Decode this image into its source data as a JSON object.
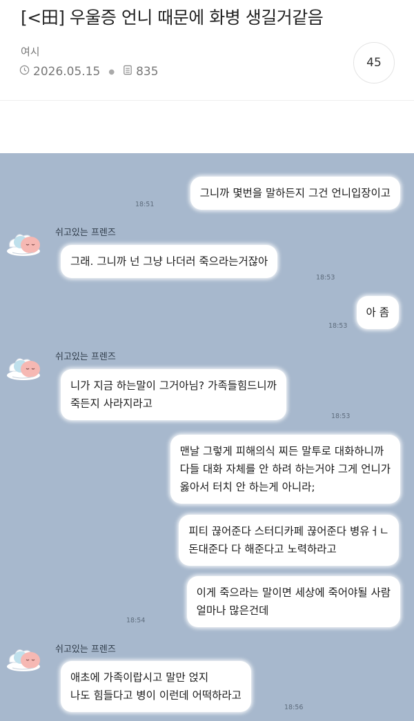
{
  "post": {
    "title": "[<田] 우울증 언니 때문에 화병 생길거같음",
    "author": "여시",
    "date": "2026.05.15",
    "views": "835",
    "comment_count": "45"
  },
  "icons": {
    "date": "clock-icon",
    "views": "document-icon",
    "avatar": "sleeping-peach-character-icon"
  },
  "colors": {
    "chat_background": "#a7b8cd",
    "bubble": "#ffffff"
  },
  "chat": {
    "friend_name": "쉬고있는 프렌즈",
    "messages": [
      {
        "lines": [
          "그니까 몇번을 말하든지 그건 언니입장이고"
        ],
        "time": "18:51"
      },
      {
        "lines": [
          "그래. 그니까 넌 그냥 나더러 죽으라는거잖아"
        ],
        "time": "18:53"
      },
      {
        "lines": [
          "아 좀"
        ],
        "time": "18:53"
      },
      {
        "lines": [
          "니가 지금 하는말이 그거아님? 가족들힘드니까",
          "죽든지 사라지라고"
        ],
        "time": "18:53"
      },
      {
        "lines": [
          "맨날 그렇게 피해의식 찌든 말투로 대화하니까",
          "다들 대화 자체를 안 하려 하는거야 그게 언니가",
          "옳아서 터치 안 하는게 아니라;"
        ]
      },
      {
        "lines": [
          "피티 끊어준다 스터디카페 끊어준다 병유ㅓㄴ",
          "돈대준다 다 해준다고 노력하라고"
        ]
      },
      {
        "lines": [
          "이게 죽으라는 말이면 세상에 죽어야될 사람",
          "얼마나 많은건데"
        ],
        "time": "18:54"
      },
      {
        "lines": [
          "애초에 가족이랍시고 말만 얹지",
          "나도 힘들다고 병이 이런데 어떡하라고"
        ],
        "time": "18:56"
      }
    ]
  }
}
